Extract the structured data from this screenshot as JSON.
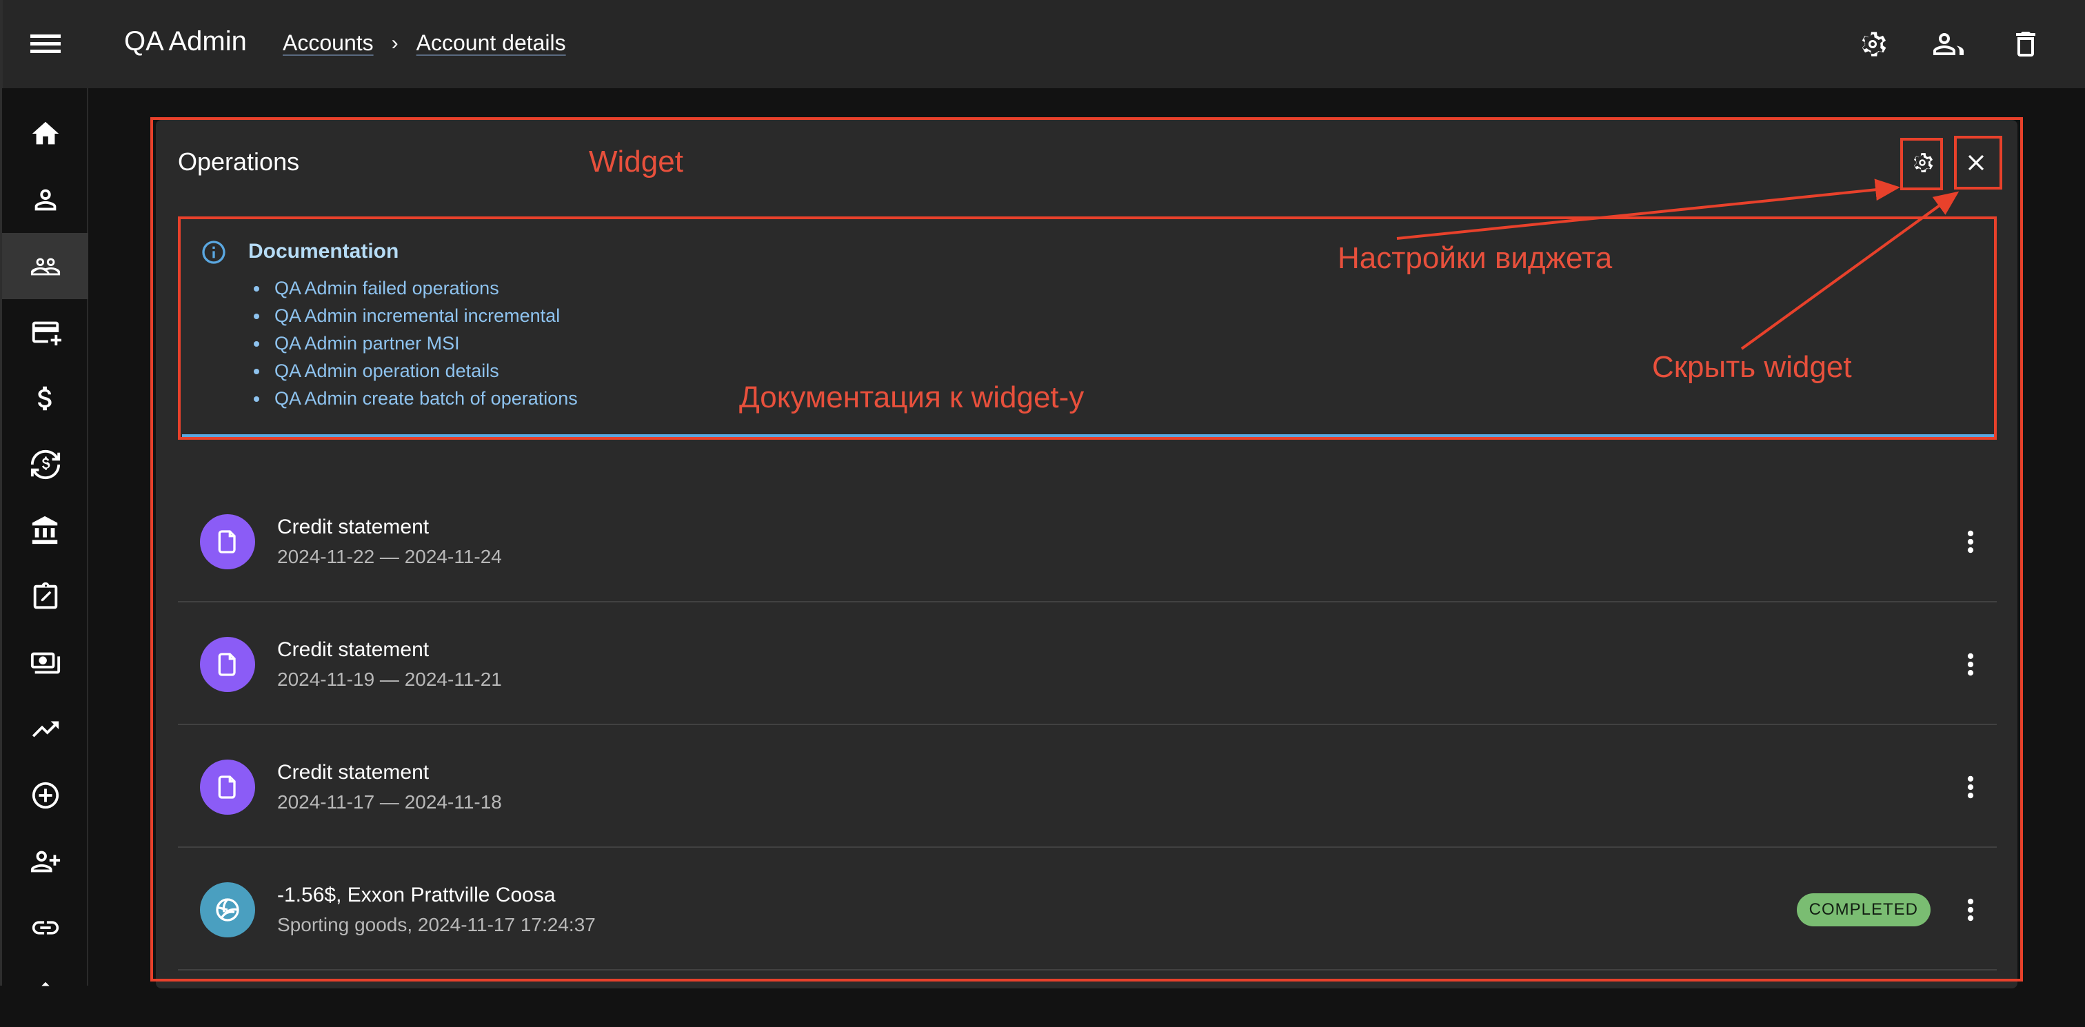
{
  "header": {
    "app_title": "QA Admin",
    "breadcrumbs": [
      {
        "label": "Accounts"
      },
      {
        "label": "Account details"
      }
    ],
    "breadcrumb_separator": "›",
    "actions": [
      {
        "icon": "gear-icon",
        "label": "Settings"
      },
      {
        "icon": "users-icon",
        "label": "Account users"
      },
      {
        "icon": "trash-icon",
        "label": "Delete"
      }
    ]
  },
  "sidebar": {
    "items": [
      {
        "icon": "home-icon",
        "active": false
      },
      {
        "icon": "person-icon",
        "active": false
      },
      {
        "icon": "group-icon",
        "active": true
      },
      {
        "icon": "add-card-icon",
        "active": false
      },
      {
        "icon": "dollar-icon",
        "active": false
      },
      {
        "icon": "currency-exchange-icon",
        "active": false
      },
      {
        "icon": "bank-icon",
        "active": false
      },
      {
        "icon": "clipboard-edit-icon",
        "active": false
      },
      {
        "icon": "payments-icon",
        "active": false
      },
      {
        "icon": "trending-up-icon",
        "active": false
      },
      {
        "icon": "add-circle-icon",
        "active": false
      },
      {
        "icon": "person-add-icon",
        "active": false
      },
      {
        "icon": "link-icon",
        "active": false
      }
    ]
  },
  "widget": {
    "title": "Operations",
    "settings_icon": "gear-icon",
    "close_icon": "close-icon",
    "documentation": {
      "title": "Documentation",
      "links": [
        "QA Admin failed operations",
        "QA Admin incremental incremental",
        "QA Admin partner MSI",
        "QA Admin operation details",
        "QA Admin create batch of operations"
      ]
    },
    "operations": [
      {
        "title": "Credit statement",
        "subtitle": "2024-11-22 — 2024-11-24",
        "icon": "document-icon",
        "avatar_color": "#8b5cf6",
        "status": null
      },
      {
        "title": "Credit statement",
        "subtitle": "2024-11-19 — 2024-11-21",
        "icon": "document-icon",
        "avatar_color": "#8b5cf6",
        "status": null
      },
      {
        "title": "Credit statement",
        "subtitle": "2024-11-17 — 2024-11-18",
        "icon": "document-icon",
        "avatar_color": "#8b5cf6",
        "status": null
      },
      {
        "title": "-1.56$, Exxon Prattville Coosa",
        "subtitle": "Sporting goods, 2024-11-17 17:24:37",
        "icon": "volleyball-icon",
        "avatar_color": "#4a9fc0",
        "status": "COMPLETED"
      }
    ]
  },
  "annotations": {
    "widget_label": "Widget",
    "settings_label": "Настройки виджета",
    "hide_label": "Скрыть widget",
    "docs_label": "Документация к widget-у",
    "color": "#e8412b"
  },
  "colors": {
    "status_completed": "#7abd72",
    "doc_link": "#8ec3ef",
    "doc_accent": "#5aa7e0"
  }
}
